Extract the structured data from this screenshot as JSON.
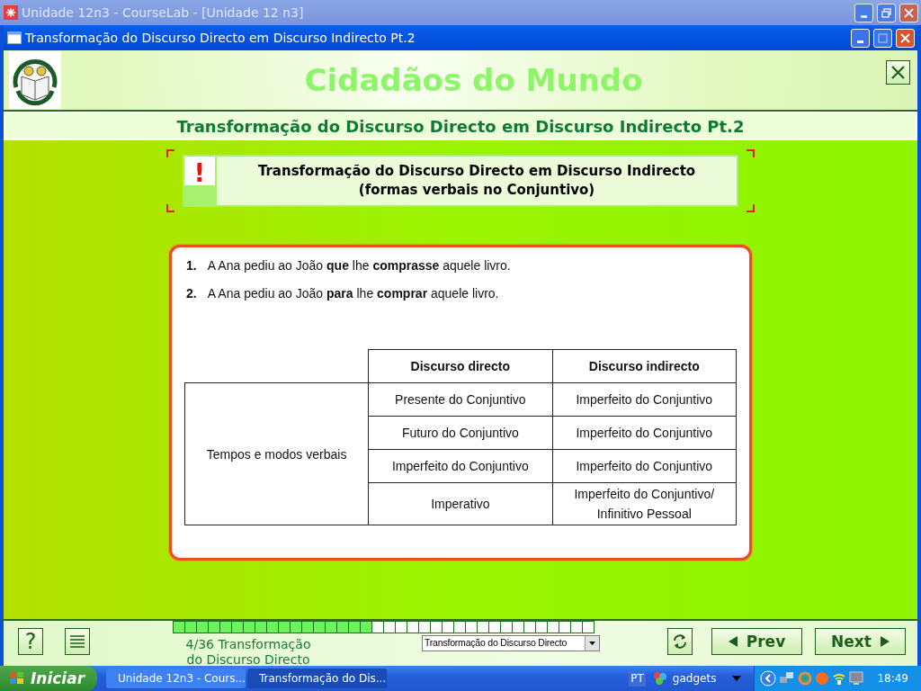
{
  "app_window": {
    "title": "Unidade 12n3 - CourseLab - [Unidade 12 n3]"
  },
  "course_window": {
    "title": "Transformação do Discurso Directo em Discurso Indirecto Pt.2"
  },
  "header": {
    "title": "Cidadãos do Mundo",
    "subtitle": "Transformação do Discurso Directo em Discurso Indirecto Pt.2"
  },
  "notice": {
    "mark": "!",
    "title": "Transformação do Discurso Directo em Discurso Indirecto",
    "subtitle": "(formas verbais no Conjuntivo)"
  },
  "examples": [
    {
      "number": "1.",
      "text": "A Ana pediu ao João **que** lhe **comprasse** aquele livro."
    },
    {
      "number": "2.",
      "text": "A Ana pediu ao João **para** lhe **comprar** aquele livro."
    }
  ],
  "table": {
    "columns": [
      "Discurso directo",
      "Discurso indirecto"
    ],
    "row_header": "Tempos e modos verbais",
    "rows": [
      [
        "Presente do Conjuntivo",
        "Imperfeito do Conjuntivo"
      ],
      [
        "Futuro do Conjuntivo",
        "Imperfeito do Conjuntivo"
      ],
      [
        "Imperfeito do Conjuntivo",
        "Imperfeito do Conjuntivo"
      ],
      [
        "Imperativo",
        "Imperfeito do Conjuntivo/ Infinitivo Pessoal"
      ]
    ]
  },
  "footer": {
    "help": "?",
    "progress": {
      "level": 0.4722
    },
    "page_label": "4/36 Transformação do Discurso Directo",
    "page_select": "Transformação do Discurso Directo",
    "prev": "Prev",
    "next": "Next"
  },
  "taskbar": {
    "start": "Iniciar",
    "tasks": [
      {
        "label": "Unidade 12n3 - Cours...",
        "selected": false
      },
      {
        "label": "Transformação do Dis...",
        "selected": true
      }
    ],
    "language": "PT",
    "gadgets": "gadgets",
    "clock": "18:49"
  }
}
